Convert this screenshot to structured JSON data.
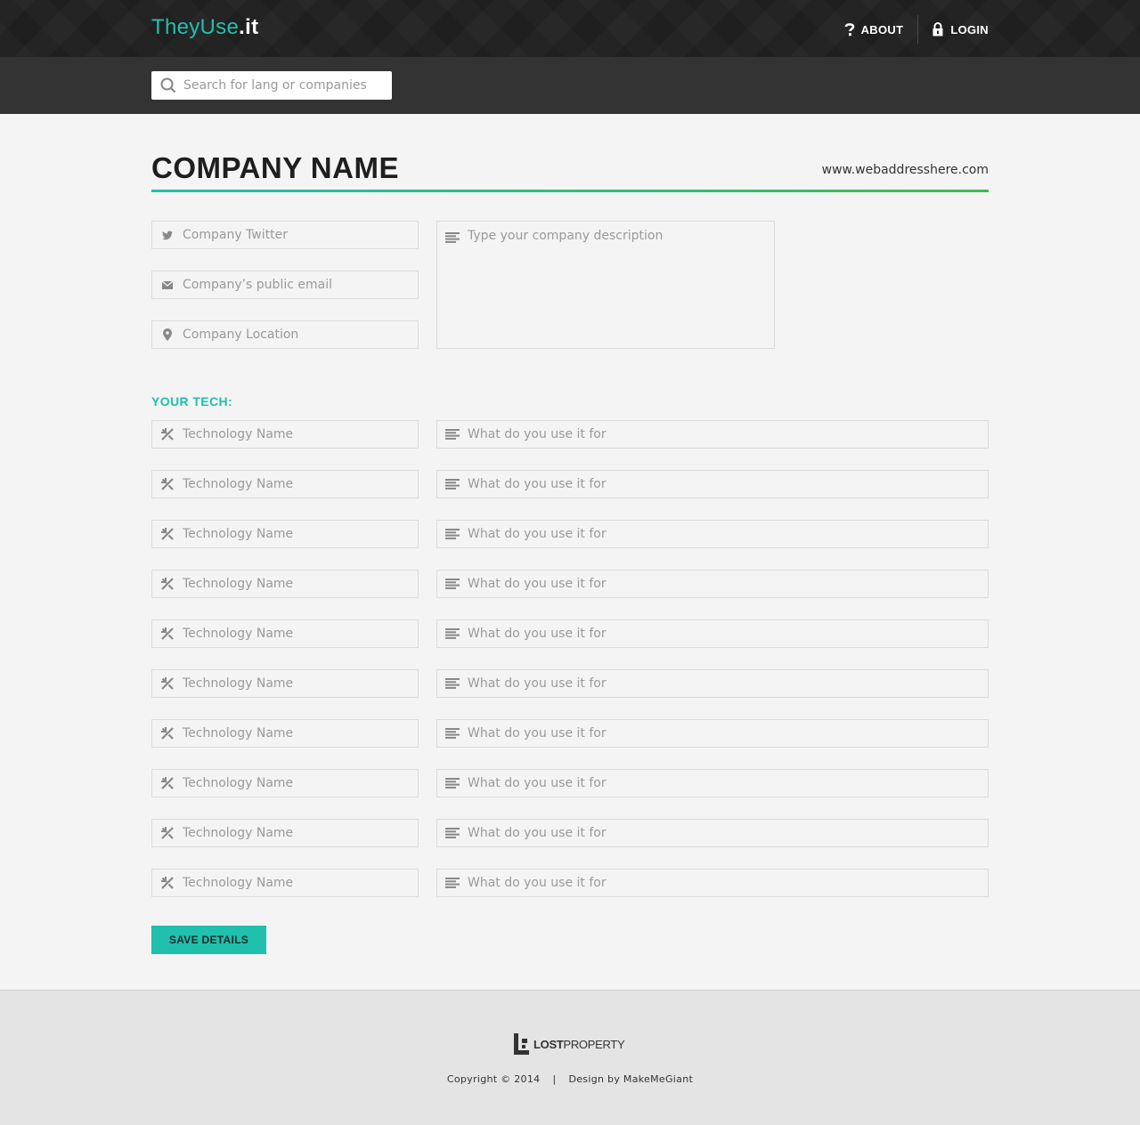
{
  "header": {
    "logo_brand": "TheyUse",
    "logo_tld": ".it",
    "nav": {
      "about": "ABOUT",
      "login": "LOGIN"
    }
  },
  "search": {
    "placeholder": "Search for lang or companies",
    "icon": "search-icon"
  },
  "company": {
    "name": "COMPANY NAME",
    "url": "www.webaddresshere.com",
    "twitter_placeholder": "Company Twitter",
    "email_placeholder": "Company’s public email",
    "location_placeholder": "Company Location",
    "description_placeholder": "Type your company description"
  },
  "tech": {
    "section_label": "YOUR TECH:",
    "name_placeholder": "Technology Name",
    "use_placeholder": "What do you use it for",
    "row_count": 10
  },
  "actions": {
    "save_label": "SAVE DETAILS"
  },
  "footer": {
    "logo_bold": "LOST",
    "logo_thin": "PROPERTY",
    "copyright": "Copyright © 2014",
    "separator": "|",
    "credit": "Design by MakeMeGiant"
  },
  "colors": {
    "accent": "#1fc0ad",
    "accent_green": "#3dbb4f",
    "header_bg": "#1f1f1f",
    "search_bg": "#333333",
    "footer_bg": "#e4e4e4"
  }
}
